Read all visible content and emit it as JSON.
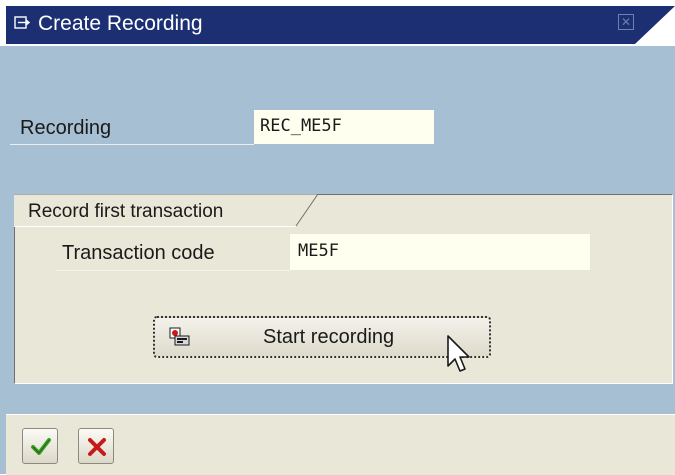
{
  "window": {
    "title": "Create Recording",
    "title_icon": "new-window-icon",
    "close_icon": "close-icon"
  },
  "form": {
    "recording_label": "Recording",
    "recording_value": "REC_ME5F"
  },
  "group": {
    "title": "Record first transaction",
    "transaction_code_label": "Transaction code",
    "transaction_code_value": "ME5F",
    "start_button_label": "Start recording",
    "start_button_icon": "record-icon"
  },
  "footer": {
    "confirm_icon": "checkmark-icon",
    "cancel_icon": "cross-icon"
  },
  "colors": {
    "titlebar": "#1c2f73",
    "background": "#a6bfd3",
    "panel": "#e9e7d8",
    "input": "#fffff0",
    "confirm": "#3aa12a",
    "cancel": "#c41a1a"
  }
}
